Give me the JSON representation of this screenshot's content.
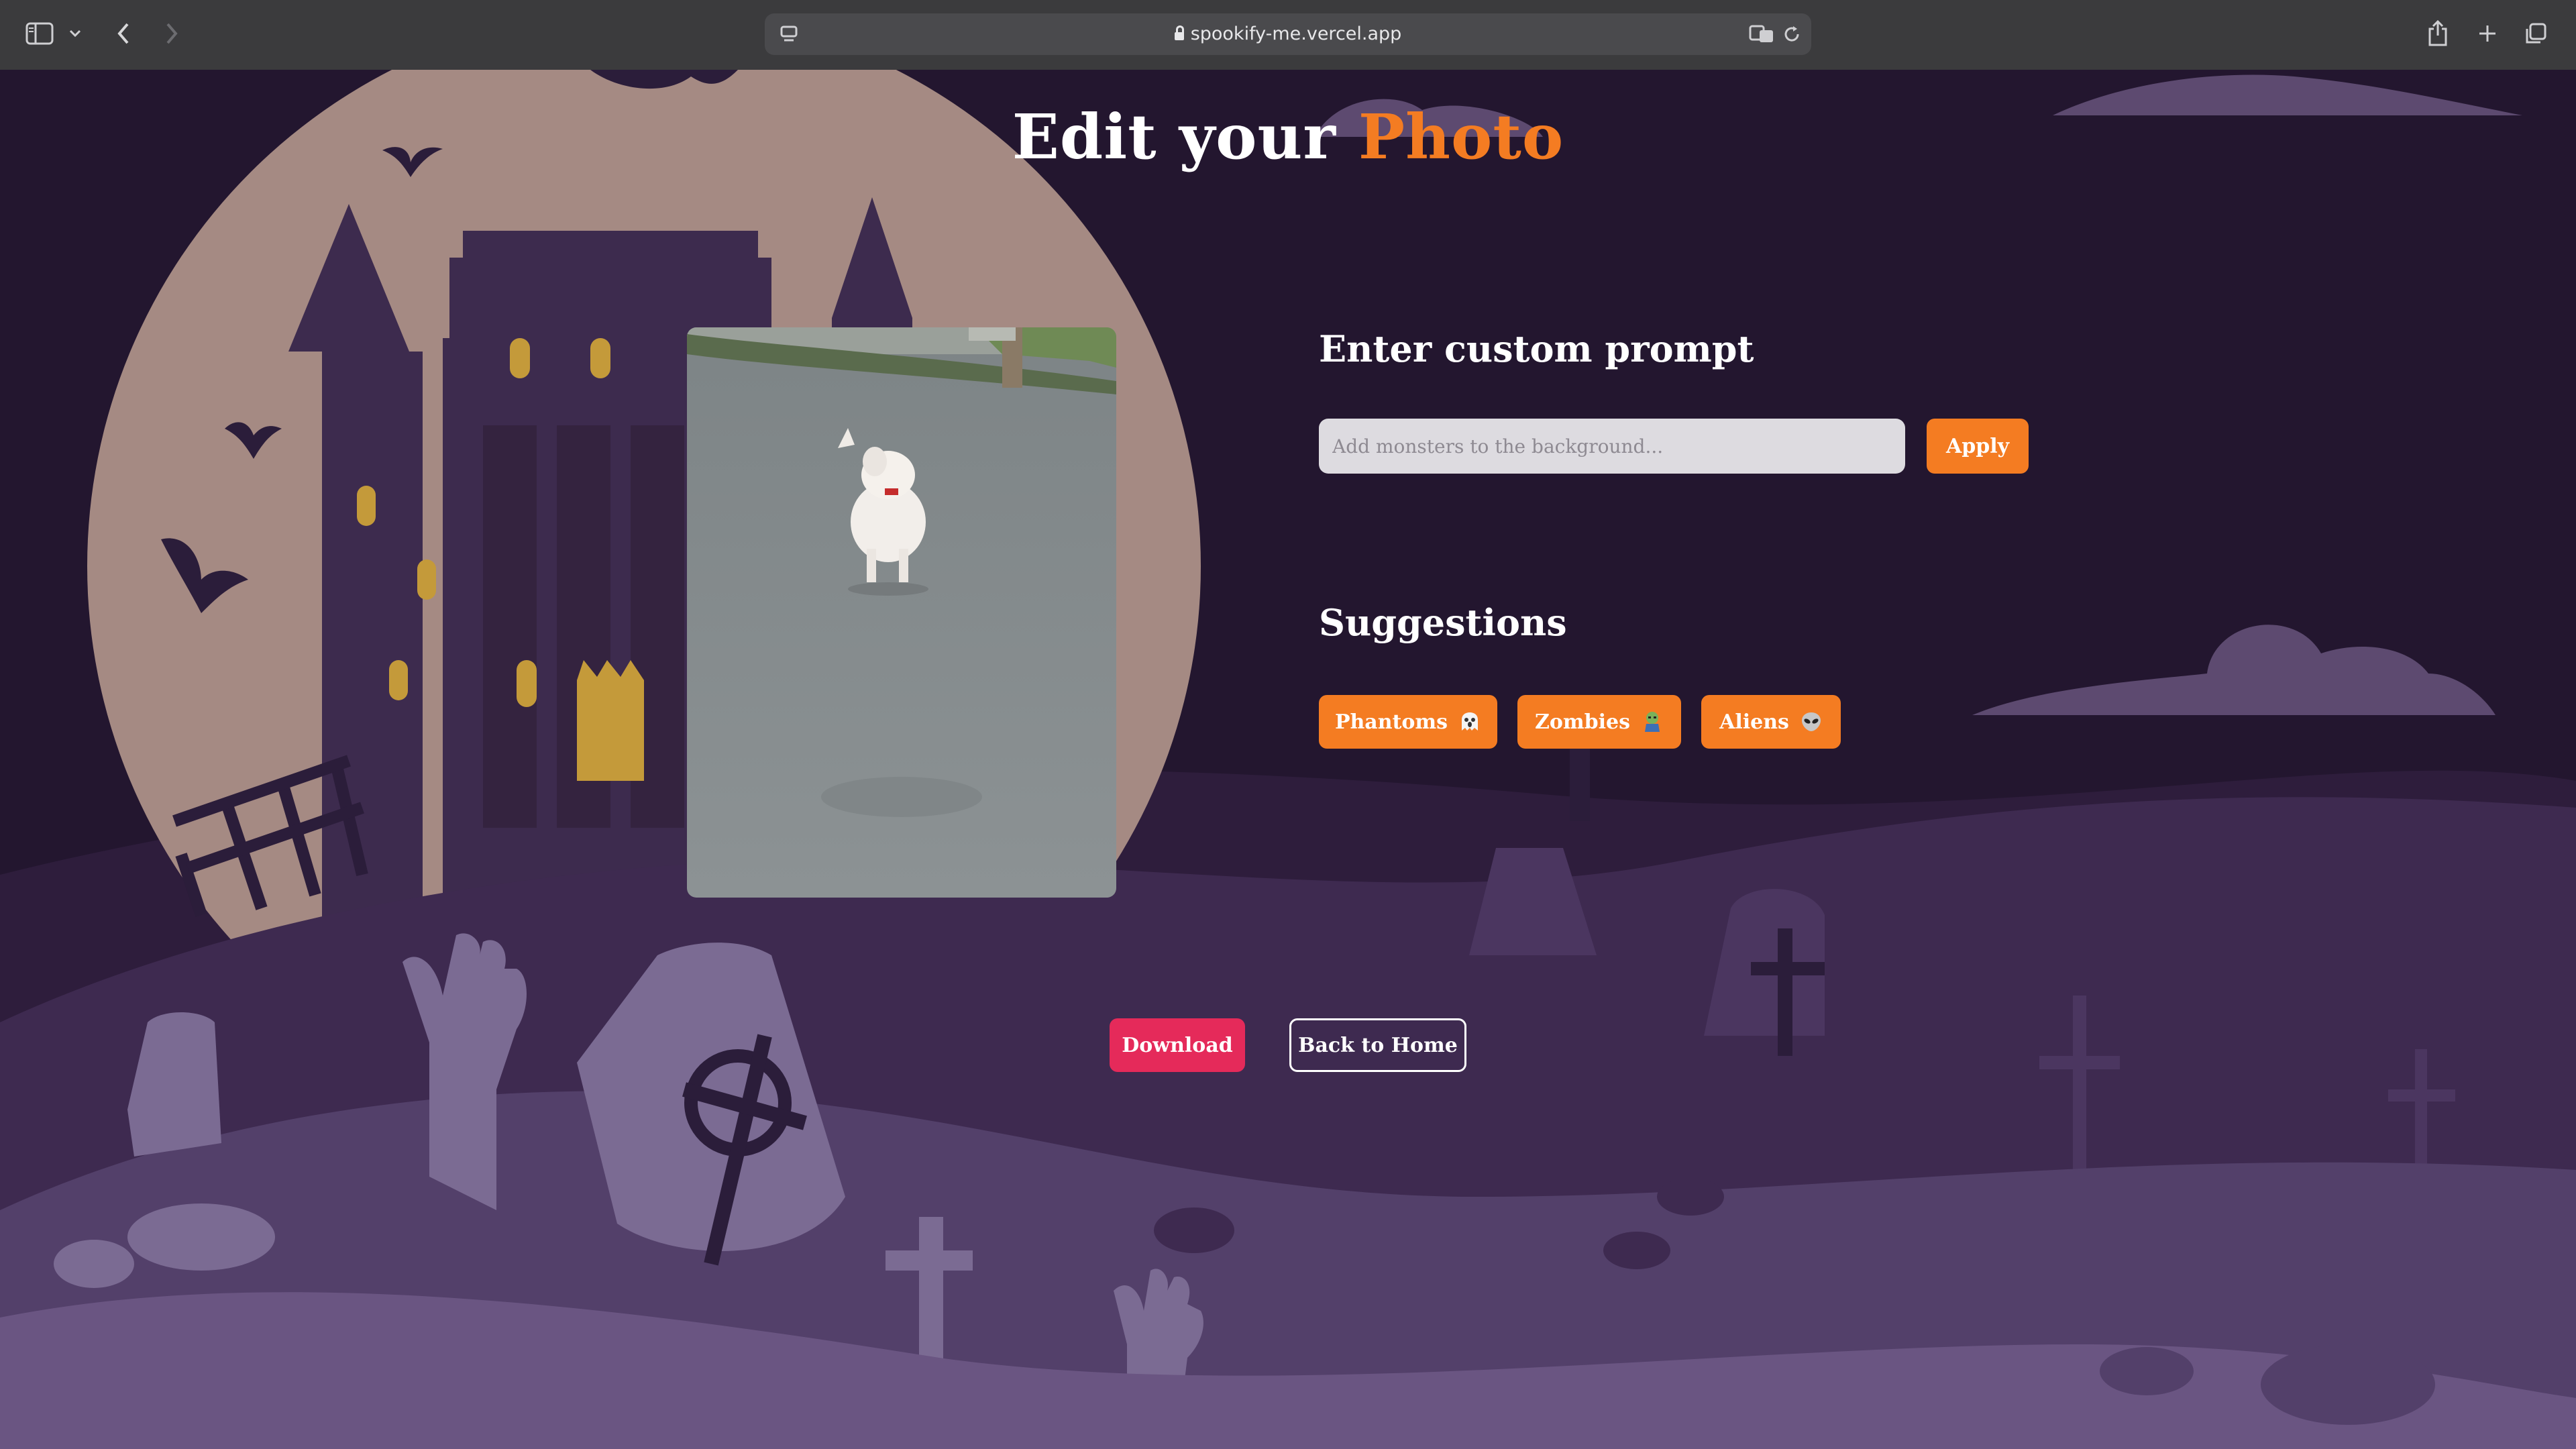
{
  "browser": {
    "url": "spookify-me.vercel.app"
  },
  "page": {
    "title_part1": "Edit your ",
    "title_part2": "Photo"
  },
  "custom_prompt": {
    "heading": "Enter custom prompt",
    "placeholder": "Add monsters to the background...",
    "value": "",
    "apply_label": "Apply"
  },
  "suggestions": {
    "heading": "Suggestions",
    "items": [
      {
        "label": "Phantoms",
        "icon": "ghost-emoji"
      },
      {
        "label": "Zombies",
        "icon": "zombie-emoji"
      },
      {
        "label": "Aliens",
        "icon": "alien-emoji"
      }
    ]
  },
  "actions": {
    "download_label": "Download",
    "home_label": "Back to Home"
  },
  "colors": {
    "accent": "#f47c22",
    "download": "#e52a5a",
    "background": "#23162f"
  }
}
